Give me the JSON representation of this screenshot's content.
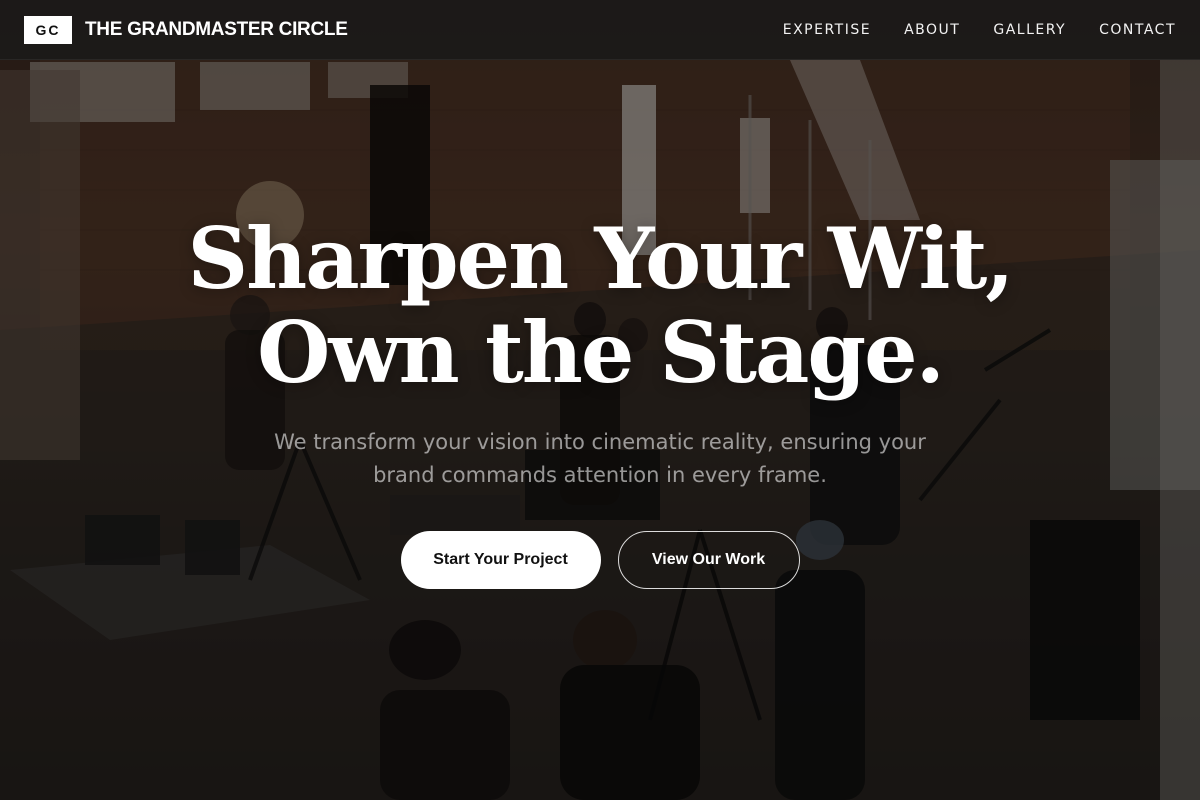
{
  "header": {
    "logo_text": "GC",
    "brand_name": "THE GRANDMASTER CIRCLE",
    "nav": [
      {
        "label": "EXPERTISE"
      },
      {
        "label": "ABOUT"
      },
      {
        "label": "GALLERY"
      },
      {
        "label": "CONTACT"
      }
    ]
  },
  "hero": {
    "headline_line1": "Sharpen Your Wit,",
    "headline_line2": "Own the Stage.",
    "subheading": "We transform your vision into cinematic reality, ensuring your brand commands attention in every frame.",
    "primary_button": "Start Your Project",
    "secondary_button": "View Our Work",
    "background_image": "film-set-warehouse-photo"
  },
  "colors": {
    "header_bg": "#1c1a19",
    "text": "#ffffff",
    "button_primary_bg": "#ffffff",
    "button_primary_text": "#111111"
  }
}
